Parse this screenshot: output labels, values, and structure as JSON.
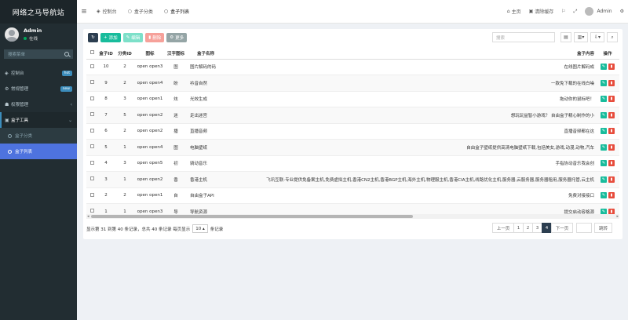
{
  "sidebar": {
    "logo": "网络之马导航站",
    "user_name": "Admin",
    "user_status": "在线",
    "search_placeholder": "搜索菜单",
    "items": [
      {
        "label": "控制台",
        "badge": "hot",
        "icon": "dashboard-icon",
        "glyph": "◈"
      },
      {
        "label": "常规管理",
        "badge": "new",
        "icon": "cogs-icon",
        "glyph": "⚙"
      },
      {
        "label": "权限管理",
        "badge": "",
        "icon": "group-icon",
        "glyph": "☗"
      },
      {
        "label": "盒子工具",
        "badge": "",
        "icon": "tools-icon",
        "glyph": "▣"
      }
    ],
    "sub_items": [
      {
        "label": "盒子分类"
      },
      {
        "label": "盒子列表"
      }
    ]
  },
  "topbar": {
    "tabs": [
      {
        "label": "控制台",
        "icon": "dashboard-icon"
      },
      {
        "label": "盒子分类",
        "icon": "circle-icon"
      },
      {
        "label": "盒子列表",
        "icon": "circle-icon"
      }
    ],
    "right": {
      "home": "主页",
      "clear_cache": "清除缓存",
      "user": "Admin"
    }
  },
  "toolbar": {
    "add": "添加",
    "edit": "编辑",
    "delete": "删除",
    "more": "更多",
    "search_placeholder": "搜索"
  },
  "table": {
    "columns": [
      "盒子ID",
      "分类ID",
      "图标",
      "汉字图标",
      "盒子名称",
      "盒子内容",
      "操作"
    ],
    "rows": [
      {
        "id": "10",
        "cat": "2",
        "icon": "open open3",
        "han": "图",
        "name": "图片解码的码",
        "content": "在线图片解码成"
      },
      {
        "id": "9",
        "cat": "2",
        "icon": "open open4",
        "han": "盼",
        "name": "衿音自然",
        "content": "一款免下载的在线白噪"
      },
      {
        "id": "8",
        "cat": "3",
        "icon": "open open1",
        "han": "炫",
        "name": "光效生成",
        "content": "拖动你的鼠标吧！"
      },
      {
        "id": "7",
        "cat": "5",
        "icon": "open open2",
        "han": "迷",
        "name": "走出迷宫",
        "content": "想玩玩益智小游戏？ 自由盒子精心制作的小"
      },
      {
        "id": "6",
        "cat": "2",
        "icon": "open open2",
        "han": "播",
        "name": "直播音频",
        "content": "直播音频都在这"
      },
      {
        "id": "5",
        "cat": "1",
        "icon": "open open4",
        "han": "图",
        "name": "电脑壁纸",
        "content": "自由盒子壁纸提供高清电脑壁纸下载,包括美女,游戏,动漫,动物,汽车"
      },
      {
        "id": "4",
        "cat": "3",
        "icon": "open open5",
        "han": "初",
        "name": "骑动音乐",
        "content": "手指协动音乐我会创"
      },
      {
        "id": "3",
        "cat": "1",
        "icon": "open open2",
        "han": "香",
        "name": "香港主机",
        "content": "飞讯互联-专业提供免备案主机,免费虚拟主机,香港CN2主机,香港BGP主机,海外主机,物理服主机,香港CIA主机,线路优化主机,服务器,云服务器,服务器租用,服务器托管,云主机"
      },
      {
        "id": "2",
        "cat": "2",
        "icon": "open open1",
        "han": "自",
        "name": "自由盒子API",
        "content": "免费对接接口"
      },
      {
        "id": "1",
        "cat": "1",
        "icon": "open open3",
        "han": "导",
        "name": "导航资源",
        "content": "提交启动容格源"
      }
    ]
  },
  "footer": {
    "summary": "显示第 31 到第 40 条记录，总共 40 条记录 每页显示",
    "page_size": "10",
    "page_size_suffix": "条记录",
    "prev": "上一页",
    "pages": [
      "1",
      "2",
      "3",
      "4"
    ],
    "current_page": "4",
    "next": "下一页",
    "go": "跳转"
  },
  "colors": {
    "sidebar_bg": "#222d32",
    "accent": "#4e73df",
    "add": "#18bc9c",
    "delete": "#e74c3c",
    "dark": "#2c3e50"
  }
}
